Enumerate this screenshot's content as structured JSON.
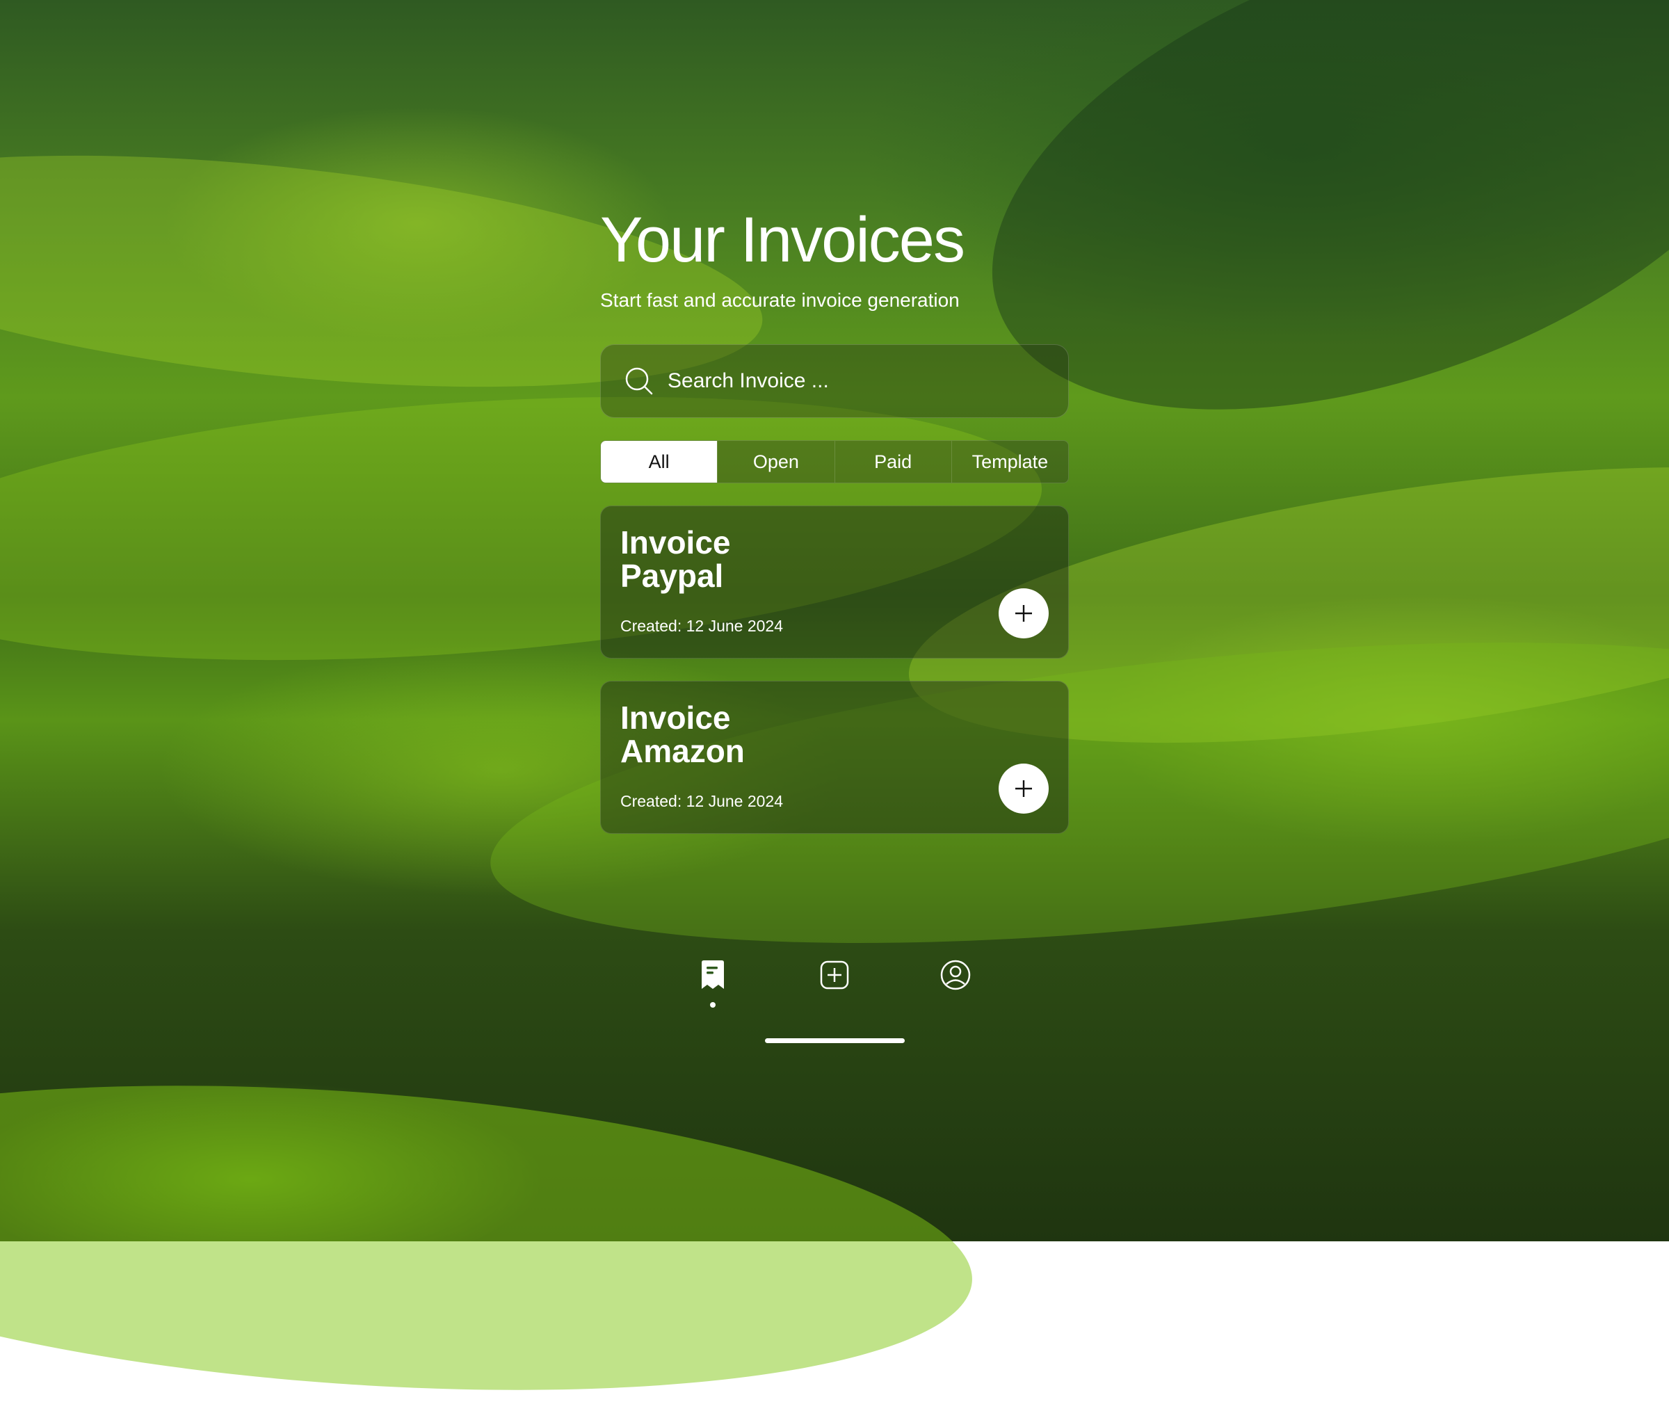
{
  "header": {
    "title": "Your Invoices",
    "subtitle": "Start fast and accurate invoice generation"
  },
  "search": {
    "placeholder": "Search Invoice ...",
    "icon": "search-icon"
  },
  "tabs": [
    {
      "label": "All",
      "active": true
    },
    {
      "label": "Open",
      "active": false
    },
    {
      "label": "Paid",
      "active": false
    },
    {
      "label": "Template",
      "active": false
    }
  ],
  "invoices": [
    {
      "title": "Invoice Paypal",
      "created": "Created: 12 June 2024",
      "action_icon": "plus-icon"
    },
    {
      "title": "Invoice Amazon",
      "created": "Created: 12 June 2024",
      "action_icon": "plus-icon"
    }
  ],
  "bottom_nav": {
    "items": [
      {
        "icon": "invoice-icon",
        "active": true
      },
      {
        "icon": "add-square-icon",
        "active": false
      },
      {
        "icon": "user-icon",
        "active": false
      }
    ]
  },
  "colors": {
    "text": "#ffffff",
    "active_tab_bg": "#ffffff",
    "active_tab_text": "#111111"
  }
}
